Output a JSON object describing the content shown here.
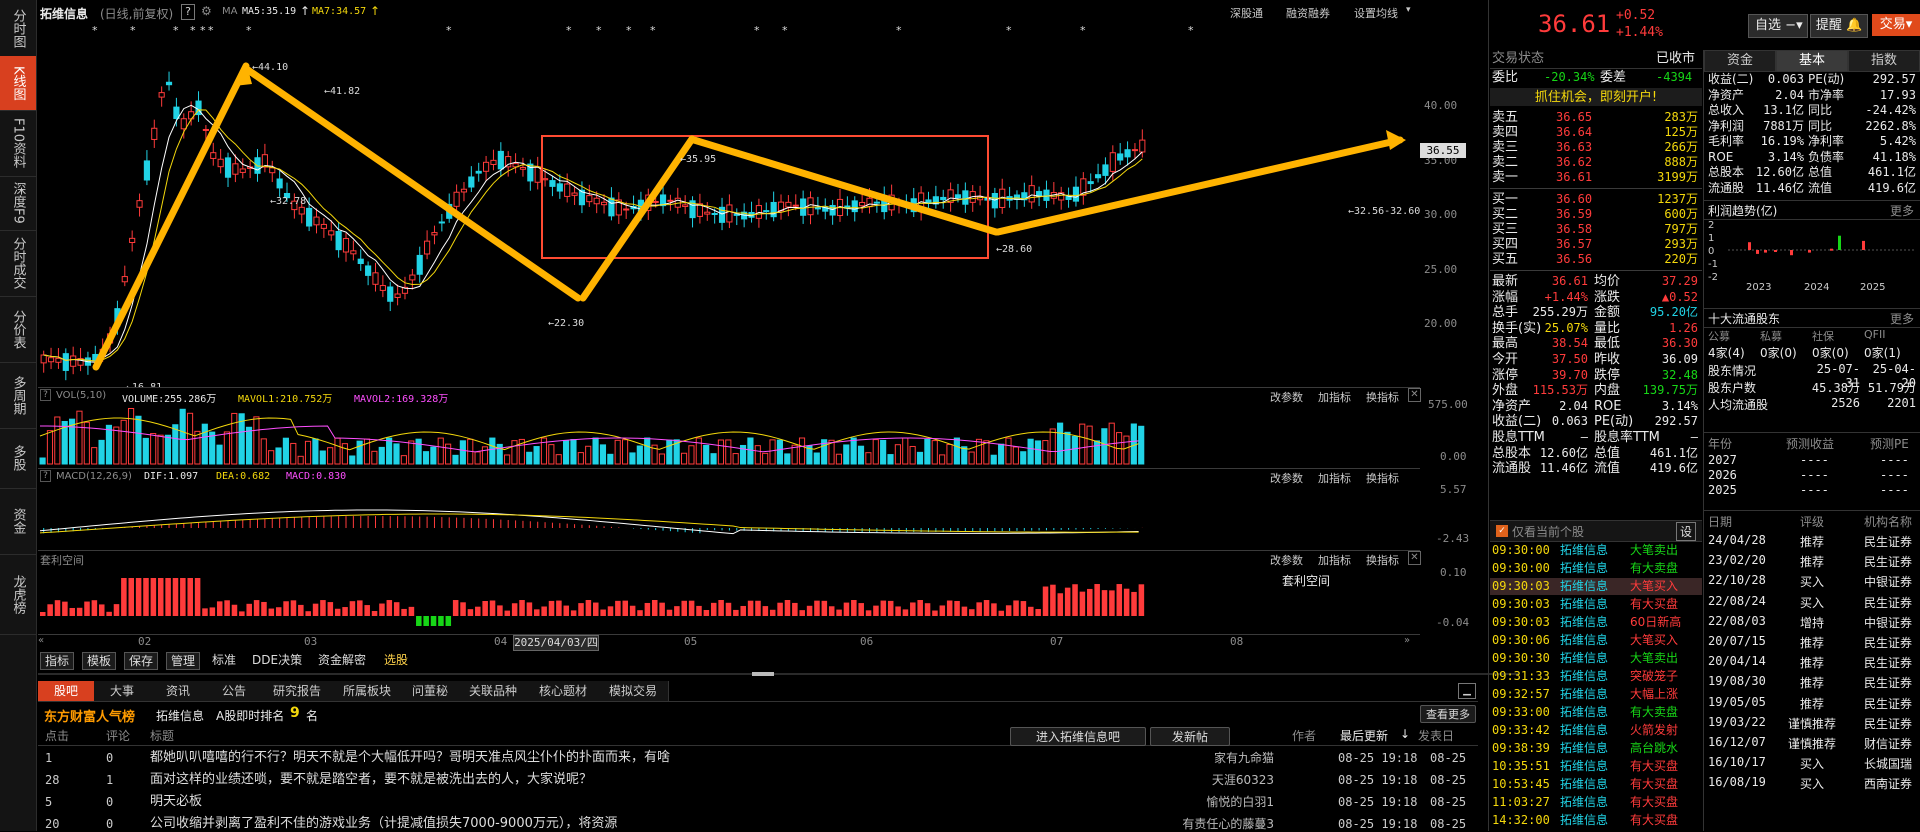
{
  "sidebar": [
    "分时图",
    "K线图",
    "F10资料",
    "深度F9",
    "分时成交",
    "分价表",
    "多周期",
    "多股",
    "资金",
    "龙虎榜"
  ],
  "sidebar_active": 1,
  "header": {
    "name": "拓维信息",
    "period": "(日线,前复权)",
    "help": "?",
    "ma_label": "MA",
    "ma5": "MA5:35.19",
    "ma7": "MA7:34.57",
    "deep": "深股通",
    "margin": "融资融券",
    "settings": "设置均线"
  },
  "main_axis": [
    "40.00",
    "35.00",
    "30.00",
    "25.00",
    "20.00"
  ],
  "price_tag": "36.55",
  "annotations": {
    "high": "44.10",
    "h2": "41.82",
    "l1": "32.78",
    "l2": "22.30",
    "low": "16.81",
    "m": "35.95",
    "m2": "28.60",
    "range": "32.56-32.60"
  },
  "colors": {
    "up": "#ff3b3b",
    "down": "#21d3e6",
    "ma5": "#ffffff",
    "ma7": "#f4d80c",
    "arrow": "#ffb300",
    "box": "#ff4b32"
  },
  "vol": {
    "label": "VOL(5,10)",
    "volume": "VOLUME:255.286万",
    "mavol1": "MAVOL1:210.752万",
    "mavol2": "MAVOL2:169.328万",
    "axis": [
      "575.00",
      "0.00"
    ]
  },
  "macd": {
    "label": "MACD(12,26,9)",
    "dif": "DIF:1.097",
    "dea": "DEA:0.682",
    "macd": "MACD:0.830",
    "axis": [
      "5.57",
      "-2.43"
    ]
  },
  "arb": {
    "label": "套利空间",
    "mid": "套利空间",
    "axis": [
      "0.10",
      "-0.04"
    ]
  },
  "panel_btns": [
    "改参数",
    "加指标",
    "换指标"
  ],
  "xaxis": [
    "02",
    "03",
    "04",
    "05",
    "06",
    "07",
    "08"
  ],
  "date_tag": "2025/04/03/四",
  "bottom_tabs": [
    "指标",
    "模板",
    "保存",
    "管理",
    "标准",
    "DDE决策",
    "资金解密",
    "选股"
  ],
  "news_tabs": [
    "股吧",
    "大事",
    "资讯",
    "公告",
    "研究报告",
    "所属板块",
    "问董秘",
    "关联品种",
    "核心题材",
    "模拟交易"
  ],
  "popularity": {
    "brand": "东方财富人气榜",
    "name": "拓维信息",
    "rank_label": "A股即时排名",
    "rank": "9",
    "unit": "名",
    "more": "查看更多"
  },
  "forum_header": {
    "clicks": "点击",
    "comments": "评论",
    "title": "标题",
    "enter": "进入拓维信息吧",
    "post": "发新帖",
    "author": "作者",
    "updated": "最后更新",
    "sort": "↓",
    "posted": "发表日"
  },
  "forum_rows": [
    {
      "c": "1",
      "r": "0",
      "t": "都她叭叭嘻嘻的行不行？明天不就是个大幅低开吗？哥明天准点风尘仆仆的扑面而来，有啥",
      "a": "家有九命猫",
      "u": "08-25 19:18",
      "p": "08-25"
    },
    {
      "c": "28",
      "r": "1",
      "t": "面对这样的业绩还唢，要不就是踏空者，要不就是被洗出去的人，大家说呢？",
      "a": "天涯60323",
      "u": "08-25 19:18",
      "p": "08-25"
    },
    {
      "c": "5",
      "r": "0",
      "t": "明天必板",
      "a": "愉悦的白羽1",
      "u": "08-25 19:18",
      "p": "08-25"
    },
    {
      "c": "20",
      "r": "0",
      "t": "公司收缩并剥离了盈利不佳的游戏业务（计提减值损失7000-9000万元），将资源",
      "a": "有责任心的藤蔓3",
      "u": "08-25 19:18",
      "p": "08-25"
    }
  ],
  "quote": {
    "price": "36.61",
    "change": "+0.52",
    "pct": "+1.44%",
    "watch": "自选",
    "alert": "提醒",
    "trade": "交易"
  },
  "status": {
    "label": "交易状态",
    "value": "已收市"
  },
  "weibi": {
    "l1": "委比",
    "v1": "-20.34%",
    "l2": "委差",
    "v2": "-4394"
  },
  "banner": "抓住机会，即刻开户!",
  "sells": [
    [
      "卖五",
      "36.65",
      "283万"
    ],
    [
      "卖四",
      "36.64",
      "125万"
    ],
    [
      "卖三",
      "36.63",
      "266万"
    ],
    [
      "卖二",
      "36.62",
      "888万"
    ],
    [
      "卖一",
      "36.61",
      "3199万"
    ]
  ],
  "buys": [
    [
      "买一",
      "36.60",
      "1237万"
    ],
    [
      "买二",
      "36.59",
      "600万"
    ],
    [
      "买三",
      "36.58",
      "797万"
    ],
    [
      "买四",
      "36.57",
      "293万"
    ],
    [
      "买五",
      "36.56",
      "220万"
    ]
  ],
  "stats": [
    [
      "最新",
      "36.61",
      "均价",
      "37.29"
    ],
    [
      "涨幅",
      "+1.44%",
      "涨跌",
      "▲0.52"
    ],
    [
      "总手",
      "255.29万",
      "金额",
      "95.20亿"
    ],
    [
      "换手(实)",
      "25.07%",
      "量比",
      "1.26"
    ],
    [
      "最高",
      "38.54",
      "最低",
      "36.30"
    ],
    [
      "今开",
      "37.50",
      "昨收",
      "36.09"
    ],
    [
      "涨停",
      "39.70",
      "跌停",
      "32.48"
    ],
    [
      "外盘",
      "115.53万",
      "内盘",
      "139.75万"
    ],
    [
      "净资产",
      "2.04",
      "ROE",
      "3.14%"
    ],
    [
      "收益(二)",
      "0.063",
      "PE(动)",
      "292.57"
    ],
    [
      "股息TTM",
      "—",
      "股息率TTM",
      "—"
    ],
    [
      "总股本",
      "12.60亿",
      "总值",
      "461.1亿"
    ],
    [
      "流通股",
      "11.46亿",
      "流值",
      "419.6亿"
    ]
  ],
  "tick_header": {
    "check": "仅看当前个股",
    "set": "设"
  },
  "ticks": [
    [
      "09:30:00",
      "拓维信息",
      "大笔卖出"
    ],
    [
      "09:30:00",
      "拓维信息",
      "有大卖盘"
    ],
    [
      "09:30:03",
      "拓维信息",
      "大笔买入"
    ],
    [
      "09:30:03",
      "拓维信息",
      "有大买盘"
    ],
    [
      "09:30:03",
      "拓维信息",
      "60日新高"
    ],
    [
      "09:30:06",
      "拓维信息",
      "大笔买入"
    ],
    [
      "09:30:30",
      "拓维信息",
      "大笔卖出"
    ],
    [
      "09:31:33",
      "拓维信息",
      "突破笼子"
    ],
    [
      "09:32:57",
      "拓维信息",
      "大幅上涨"
    ],
    [
      "09:33:00",
      "拓维信息",
      "有大卖盘"
    ],
    [
      "09:33:42",
      "拓维信息",
      "火箭发射"
    ],
    [
      "09:38:39",
      "拓维信息",
      "高台跳水"
    ],
    [
      "10:35:51",
      "拓维信息",
      "有大买盘"
    ],
    [
      "10:53:45",
      "拓维信息",
      "有大买盘"
    ],
    [
      "11:03:27",
      "拓维信息",
      "有大买盘"
    ],
    [
      "14:32:00",
      "拓维信息",
      "有大买盘"
    ]
  ],
  "far_tabs": [
    "资金",
    "基本",
    "指数"
  ],
  "fundamentals": [
    [
      "收益(二)",
      "0.063",
      "PE(动)",
      "292.57"
    ],
    [
      "净资产",
      "2.04",
      "市净率",
      "17.93"
    ],
    [
      "总收入",
      "13.1亿",
      "同比",
      "-24.42%"
    ],
    [
      "净利润",
      "7881万",
      "同比",
      "2262.8%"
    ],
    [
      "毛利率",
      "16.19%",
      "净利率",
      "5.42%"
    ],
    [
      "ROE",
      "3.14%",
      "负债率",
      "41.18%"
    ],
    [
      "总股本",
      "12.60亿",
      "总值",
      "461.1亿"
    ],
    [
      "流通股",
      "11.46亿",
      "流值",
      "419.6亿"
    ]
  ],
  "profit": {
    "title": "利润趋势(亿)",
    "more": "更多",
    "yaxis": [
      "2",
      "1",
      "0",
      "-1",
      "-2"
    ],
    "years": [
      "2023",
      "2024",
      "2025"
    ]
  },
  "holders": {
    "title": "十大流通股东",
    "more": "更多",
    "cats": [
      "公募",
      "私募",
      "社保",
      "QFII"
    ],
    "vals": [
      "4家(4)",
      "0家(0)",
      "0家(0)",
      "0家(1)"
    ],
    "rows": [
      [
        "股东情况",
        "25-07-31",
        "25-04-20"
      ],
      [
        "股东户数",
        "45.38万",
        "51.79万"
      ],
      [
        "人均流通股",
        "2526",
        "2201"
      ]
    ]
  },
  "forecast": {
    "h1": "年份",
    "h2": "预测收益",
    "h3": "预测PE",
    "rows": [
      [
        "2027",
        "----",
        "----"
      ],
      [
        "2026",
        "----",
        "----"
      ],
      [
        "2025",
        "----",
        "----"
      ]
    ]
  },
  "ratings": {
    "h1": "日期",
    "h2": "评级",
    "h3": "机构名称",
    "rows": [
      [
        "24/04/28",
        "推荐",
        "民生证券"
      ],
      [
        "23/02/20",
        "推荐",
        "民生证券"
      ],
      [
        "22/10/28",
        "买入",
        "中银证券"
      ],
      [
        "22/08/24",
        "买入",
        "民生证券"
      ],
      [
        "22/08/03",
        "增持",
        "中银证券"
      ],
      [
        "20/07/15",
        "推荐",
        "民生证券"
      ],
      [
        "20/04/14",
        "推荐",
        "民生证券"
      ],
      [
        "19/08/30",
        "推荐",
        "民生证券"
      ],
      [
        "19/05/05",
        "推荐",
        "民生证券"
      ],
      [
        "19/03/22",
        "谨慎推荐",
        "民生证券"
      ],
      [
        "16/12/07",
        "谨慎推荐",
        "财信证券"
      ],
      [
        "16/10/17",
        "买入",
        "长城国瑞"
      ],
      [
        "16/08/19",
        "买入",
        "西南证券"
      ]
    ]
  }
}
